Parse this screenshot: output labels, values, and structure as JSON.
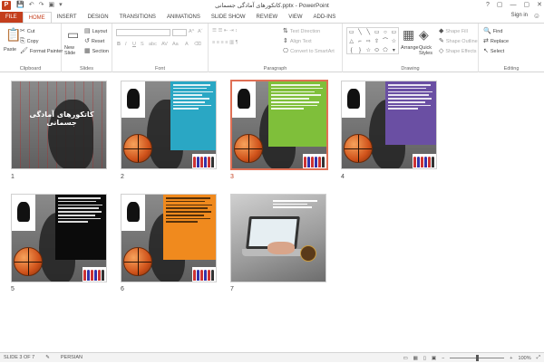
{
  "window": {
    "title": "کاتکورهای آمادگی جسمانی.pptx - PowerPoint",
    "app_icon": "P",
    "controls": [
      "?",
      "▢",
      "—",
      "▢",
      "✕"
    ]
  },
  "qat": {
    "save_icon": "save-icon",
    "undo_icon": "undo-icon",
    "redo_icon": "redo-icon",
    "present_icon": "present-icon"
  },
  "tabs": [
    "FILE",
    "HOME",
    "INSERT",
    "DESIGN",
    "TRANSITIONS",
    "ANIMATIONS",
    "SLIDE SHOW",
    "REVIEW",
    "VIEW",
    "ADD-INS"
  ],
  "active_tab": "HOME",
  "account": {
    "sign_in": "Sign in"
  },
  "ribbon": {
    "clipboard": {
      "label": "Clipboard",
      "paste": "Paste",
      "cut": "Cut",
      "copy": "Copy",
      "format_painter": "Format Painter"
    },
    "slides": {
      "label": "Slides",
      "new_slide": "New Slide",
      "layout": "Layout",
      "reset": "Reset",
      "section": "Section"
    },
    "font": {
      "label": "Font"
    },
    "paragraph": {
      "label": "Paragraph",
      "text_direction": "Text Direction",
      "align_text": "Align Text",
      "convert_smartart": "Convert to SmartArt"
    },
    "drawing": {
      "label": "Drawing",
      "arrange": "Arrange",
      "quick_styles": "Quick Styles",
      "shape_fill": "Shape Fill",
      "shape_outline": "Shape Outline",
      "shape_effects": "Shape Effects"
    },
    "editing": {
      "label": "Editing",
      "find": "Find",
      "replace": "Replace",
      "select": "Select"
    }
  },
  "slides": [
    {
      "num": "1",
      "title": "کاتکورهای آمادگی جسمانی"
    },
    {
      "num": "2"
    },
    {
      "num": "3",
      "selected": true
    },
    {
      "num": "4"
    },
    {
      "num": "5"
    },
    {
      "num": "6"
    },
    {
      "num": "7"
    }
  ],
  "status": {
    "slide_info": "SLIDE 3 OF 7",
    "language": "PERSIAN",
    "zoom": "100%",
    "zoom_level": 1.0
  },
  "colors": {
    "accent": "#c43e1c",
    "slide2_panel": "#2aa7c4",
    "slide3_panel": "#7fbf3a",
    "slide4_panel": "#6a4fa3",
    "slide5_panel": "#0b0b0b",
    "slide6_panel": "#f08a1e"
  }
}
